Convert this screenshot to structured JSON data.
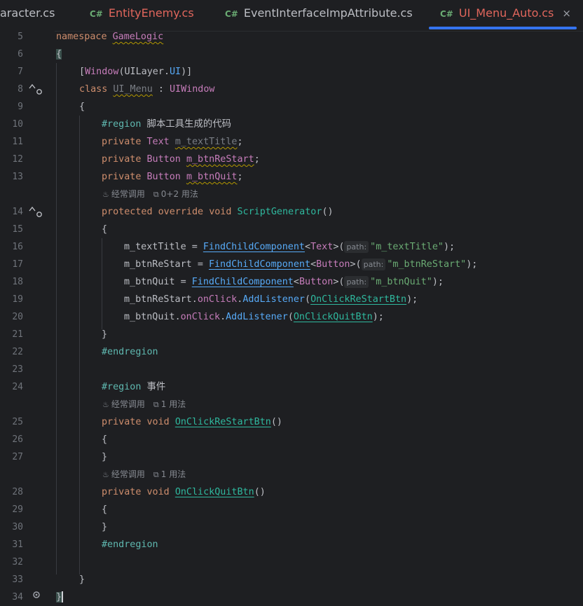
{
  "tabs": [
    {
      "label": "aracter.cs",
      "icon": "",
      "active": false
    },
    {
      "label": "EntityEnemy.cs",
      "icon": "C#",
      "active": false
    },
    {
      "label": "EventInterfaceImpAttribute.cs",
      "icon": "C#",
      "active": false
    },
    {
      "label": "UI_Menu_Auto.cs",
      "icon": "C#",
      "active": true
    }
  ],
  "close_symbol": "×",
  "line_numbers": [
    "5",
    "6",
    "7",
    "8",
    "9",
    "10",
    "11",
    "12",
    "13",
    "14",
    "15",
    "16",
    "17",
    "18",
    "19",
    "20",
    "21",
    "22",
    "23",
    "24",
    "25",
    "26",
    "27",
    "28",
    "29",
    "30",
    "31",
    "32",
    "33",
    "34"
  ],
  "code": {
    "namespace_kw": "namespace",
    "namespace_name": "GameLogic",
    "attr_window": "Window",
    "attr_layer": "UILayer",
    "attr_ui": "UI",
    "class_kw": "class",
    "class_name": "UI_Menu",
    "base_class": "UIWindow",
    "region1": "#region",
    "region1_label": "脚本工具生成的代码",
    "private": "private",
    "t_text": "Text",
    "t_button": "Button",
    "f_title": "m_textTitle",
    "f_restart": "m_btnReStart",
    "f_quit": "m_btnQuit",
    "protected": "protected",
    "override": "override",
    "void": "void",
    "script_gen": "ScriptGenerator",
    "find": "FindChildComponent",
    "param_hint": "path:",
    "s_title": "\"m_textTitle\"",
    "s_restart": "\"m_btnReStart\"",
    "s_quit": "\"m_btnQuit\"",
    "onclick": "onClick",
    "addlistener": "AddListener",
    "h_restart": "OnClickReStartBtn",
    "h_quit": "OnClickQuitBtn",
    "endregion": "#endregion",
    "region2_label": "事件"
  },
  "hints": {
    "usage": "经常调用",
    "uses_a": "0+2 用法",
    "uses_b": "1 用法",
    "uses_c": "1 用法"
  },
  "colors": {
    "background": "#1e1f22",
    "keyword": "#cf8e6d",
    "type": "#c77dbb",
    "string": "#6aab73",
    "method": "#57aaf7",
    "active_tab_underline": "#3574f0"
  }
}
